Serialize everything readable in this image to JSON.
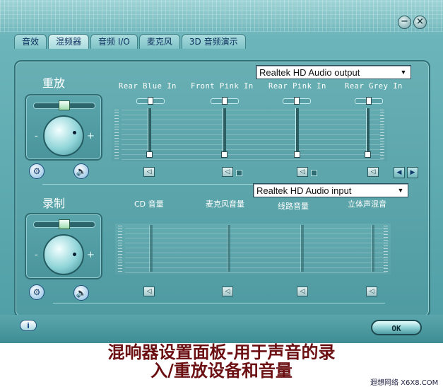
{
  "tabs": [
    {
      "label": "音效"
    },
    {
      "label": "混频器"
    },
    {
      "label": "音频 I/O"
    },
    {
      "label": "麦克风"
    },
    {
      "label": "3D 音频演示"
    }
  ],
  "playback": {
    "label": "重放",
    "minus": "-",
    "plus": "+",
    "device": "Realtek HD Audio output",
    "channels": [
      {
        "label": "Rear Blue In",
        "level": 0.0
      },
      {
        "label": "Front Pink In",
        "level": 0.0
      },
      {
        "label": "Rear Pink In",
        "level": 0.0
      },
      {
        "label": "Rear Grey In",
        "level": 0.0
      }
    ]
  },
  "record": {
    "label": "录制",
    "minus": "-",
    "plus": "+",
    "device": "Realtek HD Audio input",
    "channels": [
      {
        "label": "CD 音量"
      },
      {
        "label": "麦克风音量"
      },
      {
        "label": "线路音量"
      },
      {
        "label": "立体声混音"
      }
    ]
  },
  "buttons": {
    "ok": "OK",
    "info": "i",
    "minimize": "−",
    "close": "×"
  },
  "caption": {
    "line1": "混响器设置面板-用于声音的录",
    "line2": "入/重放设备和音量"
  },
  "watermark": "遐想网络 X6X8.COM"
}
